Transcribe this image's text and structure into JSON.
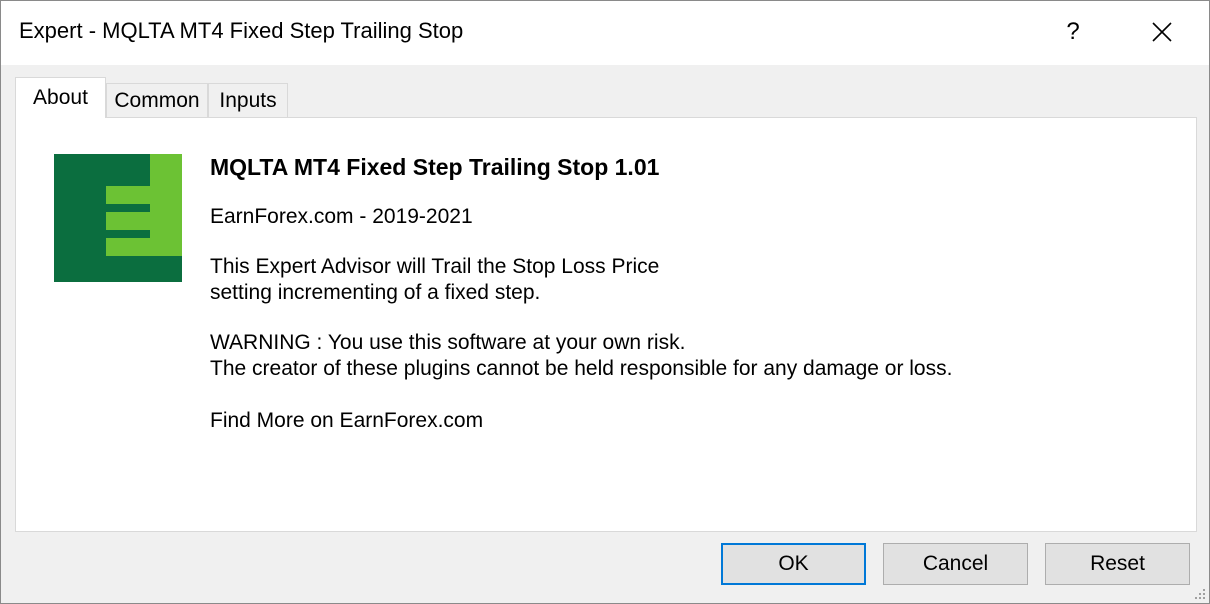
{
  "window": {
    "title": "Expert - MQLTA MT4 Fixed Step Trailing Stop",
    "help_label": "?"
  },
  "tabs": [
    {
      "label": "About",
      "active": true
    },
    {
      "label": "Common",
      "active": false
    },
    {
      "label": "Inputs",
      "active": false
    }
  ],
  "about": {
    "title": "MQLTA MT4 Fixed Step Trailing Stop 1.01",
    "copyright": "EarnForex.com - 2019-2021",
    "description_line1": "This Expert Advisor will Trail the Stop Loss Price",
    "description_line2": "setting incrementing of a fixed step.",
    "warning_line1": "WARNING : You use this software at your own risk.",
    "warning_line2": "The creator of these plugins cannot be held responsible for any damage or loss.",
    "find_more": "Find More on EarnForex.com"
  },
  "buttons": {
    "ok_label": "OK",
    "cancel_label": "Cancel",
    "reset_label": "Reset"
  },
  "colors": {
    "logo_dark_green": "#0b6e3f",
    "logo_light_green": "#6cc234",
    "default_button_border": "#0078d7"
  }
}
